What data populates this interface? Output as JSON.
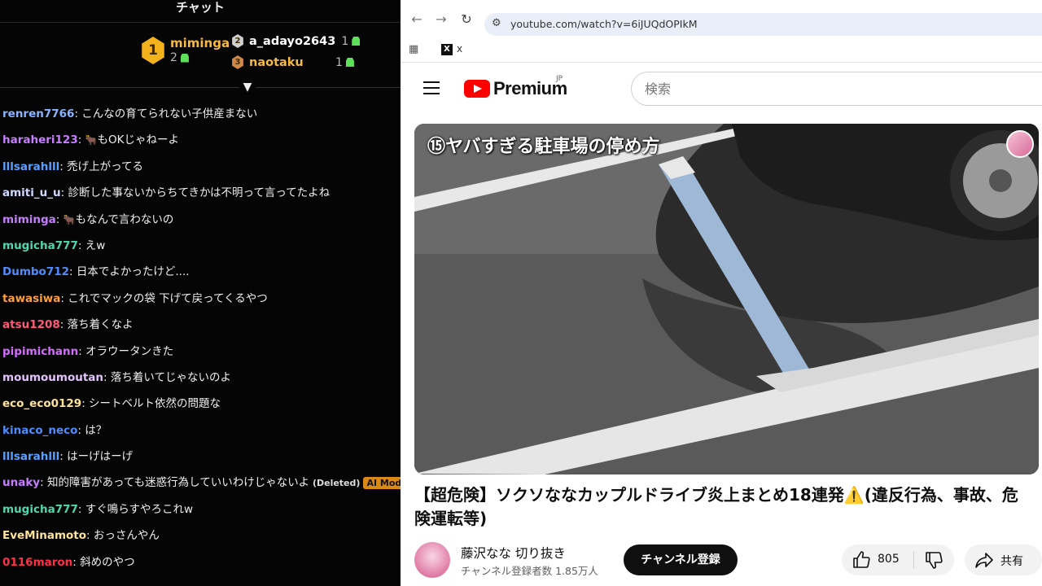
{
  "chat": {
    "title": "チャット",
    "leaders": [
      {
        "rank": "1",
        "name": "mimin­ga",
        "bits": "2"
      },
      {
        "rank": "2",
        "name": "a_adayo2643",
        "bits": "1"
      },
      {
        "rank": "3",
        "name": "naotaku",
        "bits": "1"
      }
    ],
    "messages": [
      {
        "user": "renren7766",
        "color": "#8ab4ff",
        "text": "こんなの育てられない子供産まない"
      },
      {
        "user": "haraheri123",
        "color": "#c77dff",
        "emote": "🐂",
        "text": "もOKじゃねーよ"
      },
      {
        "user": "lllsarahlll",
        "color": "#5aa0ff",
        "text": "禿げ上がってる"
      },
      {
        "user": "amiti_u_u",
        "color": "#cfd8ff",
        "text": "診断した事ないからちてきかは不明って言ってたよね"
      },
      {
        "user": "miminga",
        "color": "#c77dff",
        "emote": "🐂",
        "text": "もなんで言わないの"
      },
      {
        "user": "mugicha777",
        "color": "#4fd8b0",
        "text": "えw"
      },
      {
        "user": "Dumbo712",
        "color": "#4f8dff",
        "text": "日本でよかったけど...."
      },
      {
        "user": "tawasiwa",
        "color": "#ff9f3a",
        "text": "これでマックの袋 下げて戻ってくるやつ"
      },
      {
        "user": "atsu1208",
        "color": "#ff5a78",
        "text": "落ち着くなよ"
      },
      {
        "user": "pipimichann",
        "color": "#d46cff",
        "text": "オラウータンきた"
      },
      {
        "user": "moumoumoutan",
        "color": "#e4c2ff",
        "text": "落ち着いてじゃないのよ"
      },
      {
        "user": "eco_eco0129",
        "color": "#ffe39a",
        "text": "シートベルト依然の問題な"
      },
      {
        "user": "kinaco_neco",
        "color": "#4f8dff",
        "text": "は？"
      },
      {
        "user": "lllsarahlll",
        "color": "#5aa0ff",
        "text": "はーげはーげ"
      },
      {
        "user": "unaky",
        "color": "#c77dff",
        "text": "知的障害があっても迷惑行為していいわけじゃないよ",
        "deleted": "(Deleted)",
        "mod": "AI Mod"
      },
      {
        "user": "mugicha777",
        "color": "#4fd8b0",
        "text": "すぐ鳴らすやろこれw"
      },
      {
        "user": "EveMinamoto",
        "color": "#ffe39a",
        "text": "おっさんやん"
      },
      {
        "user": "0116maron",
        "color": "#ff3048",
        "text": "斜めのやつ"
      }
    ]
  },
  "browser": {
    "url": "youtube.com/watch?v=6iJUQdOPIkM",
    "bookmark_label": "x",
    "brand": "Premium",
    "region": "JP",
    "search_placeholder": "検索",
    "video_caption": "⑮ヤバすぎる駐車場の停め方",
    "video_title": "【超危険】ソクソななカップルドライブ炎上まとめ18連発⚠️(違反行為、事故、危険運転等)",
    "channel_name": "藤沢なな 切り抜き",
    "channel_subs": "チャンネル登録者数 1.85万人",
    "subscribe_label": "チャンネル登録",
    "like_count": "805",
    "share_label": "共有"
  }
}
